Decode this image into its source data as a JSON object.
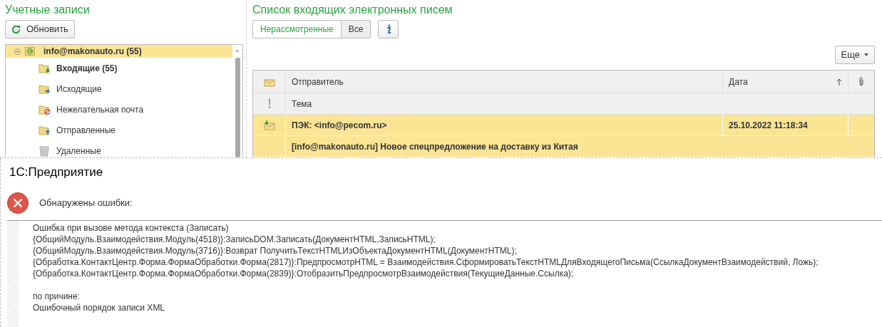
{
  "accounts": {
    "title": "Учетные записи",
    "refresh_button": "Обновить",
    "tree": [
      {
        "label": "info@makonauto.ru (55)",
        "selected": true,
        "expanded": true,
        "children": [
          {
            "label": "Входящие (55)",
            "kind": "inbox",
            "unread": true
          },
          {
            "label": "Исходящие",
            "kind": "outbox",
            "unread": false
          },
          {
            "label": "Нежелательная почта",
            "kind": "spam",
            "unread": false
          },
          {
            "label": "Отправленные",
            "kind": "sent",
            "unread": false
          },
          {
            "label": "Удаленные",
            "kind": "trash",
            "unread": false
          }
        ]
      }
    ]
  },
  "inbox": {
    "title": "Список входящих электронных писем",
    "filter_tabs": [
      {
        "label": "Нерассмотренные",
        "selected": true
      },
      {
        "label": "Все",
        "selected": false
      }
    ],
    "more_button": "Еще",
    "table": {
      "columns": [
        "Отправитель",
        "Дата"
      ],
      "subject_column": "Тема",
      "rows": [
        {
          "sender": "ПЭК: <info@pecom.ru>",
          "date": "25.10.2022 11:18:34",
          "subject": "[info@makonauto.ru] Новое спецпредложение на доставку из Китая",
          "selected": true
        }
      ]
    }
  },
  "dialog": {
    "title": "1С:Предприятие",
    "message": "Обнаружены ошибки:",
    "details": {
      "trace": [
        "Ошибка при вызове метода контекста (Записать)",
        "{ОбщийМодуль.Взаимодействия.Модуль(4518)}:ЗаписьDOM.Записать(ДокументHTML,ЗаписьHTML);",
        "{ОбщийМодуль.Взаимодействия.Модуль(3716)}:Возврат ПолучитьТекстHTMLИзОбъектаДокументHTML(ДокументHTML);",
        "{Обработка.КонтактЦентр.Форма.ФормаОбработки.Форма(2817)}:ПредпросмотрHTML = Взаимодействия.СформироватьТекстHTMLДляВходящегоПисьма(СсылкаДокументВзаимодействий, Ложь);",
        "{Обработка.КонтактЦентр.Форма.ФормаОбработки.Форма(2839)}:ОтобразитьПредпросмотрВзаимодействия(ТекущиеДанные.Ссылка);"
      ],
      "reason": [
        "по причине:",
        "Ошибочный порядок записи XML"
      ]
    }
  }
}
